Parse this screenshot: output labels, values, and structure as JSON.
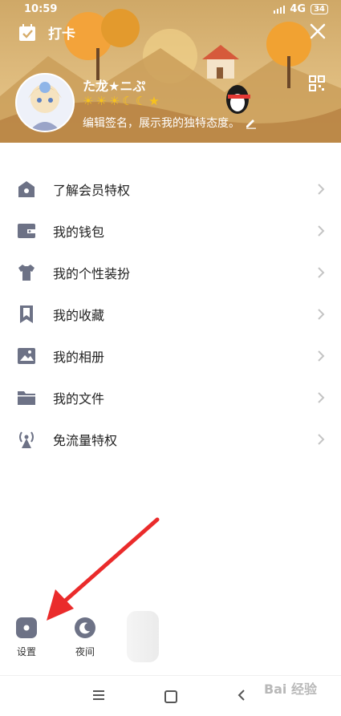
{
  "status": {
    "time": "10:59",
    "network": "4G",
    "battery": "34"
  },
  "topbar": {
    "checkin_label": "打卡"
  },
  "profile": {
    "nickname": "た龙★ニぷ",
    "level_icons": [
      "☀",
      "☀",
      "☀",
      "☾",
      "☾",
      "★"
    ],
    "signature": "编辑签名，展示我的独特态度。"
  },
  "menu": [
    {
      "label": "了解会员特权",
      "icon": "vip-house-icon"
    },
    {
      "label": "我的钱包",
      "icon": "wallet-icon"
    },
    {
      "label": "我的个性装扮",
      "icon": "tshirt-icon"
    },
    {
      "label": "我的收藏",
      "icon": "bookmark-icon"
    },
    {
      "label": "我的相册",
      "icon": "photo-icon"
    },
    {
      "label": "我的文件",
      "icon": "folder-icon"
    },
    {
      "label": "免流量特权",
      "icon": "broadcast-icon"
    }
  ],
  "bottom": {
    "settings_label": "设置",
    "night_label": "夜间"
  },
  "watermark": "Bai 经验",
  "colors": {
    "accent_gray": "#6d7286",
    "header_warm": "#dcb87a"
  }
}
